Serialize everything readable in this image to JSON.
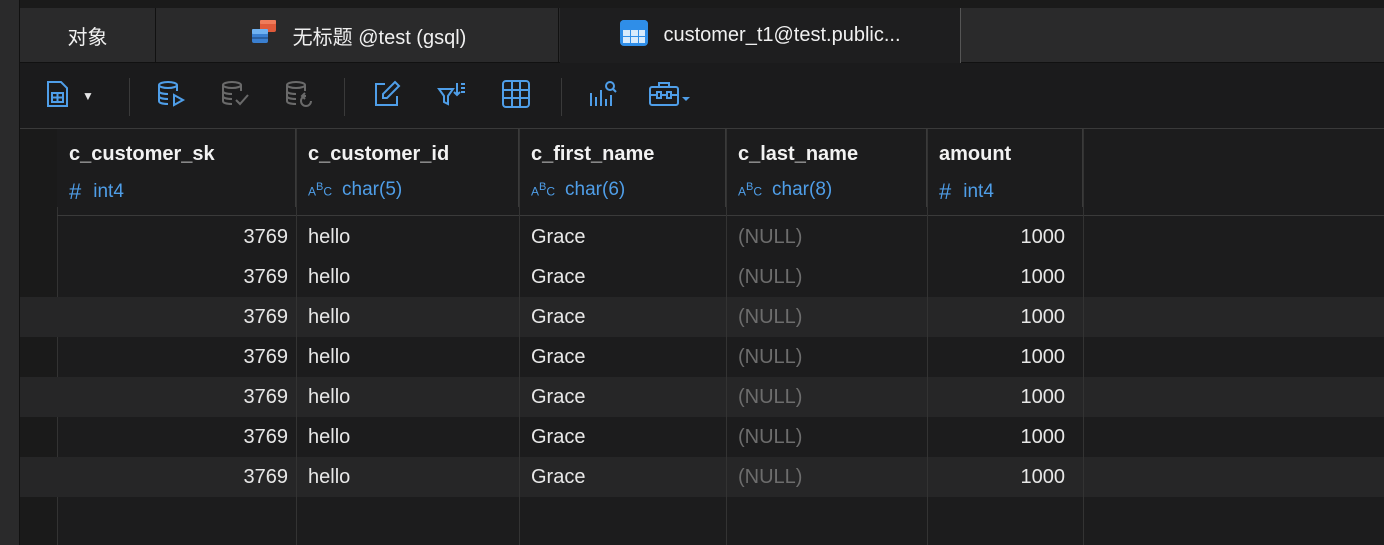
{
  "tabs": [
    {
      "label": "对象",
      "icon": "objects-tab"
    },
    {
      "label": "无标题 @test (gsql)",
      "icon": "query-editor-icon"
    },
    {
      "label": "customer_t1@test.public...",
      "icon": "table-icon"
    }
  ],
  "toolbar": {
    "icons": [
      "form-view-icon",
      "dropdown-caret-icon",
      "begin-transaction-icon",
      "commit-icon",
      "rollback-icon",
      "edit-text-icon",
      "filter-sort-icon",
      "grid-view-icon",
      "chart-search-icon",
      "tools-briefcase-icon"
    ]
  },
  "grid": {
    "columns": [
      {
        "name": "c_customer_sk",
        "type": "int4",
        "type_kind": "number"
      },
      {
        "name": "c_customer_id",
        "type": "char(5)",
        "type_kind": "text"
      },
      {
        "name": "c_first_name",
        "type": "char(6)",
        "type_kind": "text"
      },
      {
        "name": "c_last_name",
        "type": "char(8)",
        "type_kind": "text"
      },
      {
        "name": "amount",
        "type": "int4",
        "type_kind": "number"
      }
    ],
    "type_glyphs": {
      "number": "#",
      "text": "ABC"
    },
    "rows": [
      [
        "3769",
        "hello",
        "Grace",
        "(NULL)",
        "1000"
      ],
      [
        "3769",
        "hello",
        "Grace",
        "(NULL)",
        "1000"
      ],
      [
        "3769",
        "hello",
        "Grace",
        "(NULL)",
        "1000"
      ],
      [
        "3769",
        "hello",
        "Grace",
        "(NULL)",
        "1000"
      ],
      [
        "3769",
        "hello",
        "Grace",
        "(NULL)",
        "1000"
      ],
      [
        "3769",
        "hello",
        "Grace",
        "(NULL)",
        "1000"
      ],
      [
        "3769",
        "hello",
        "Grace",
        "(NULL)",
        "1000"
      ]
    ]
  },
  "colors": {
    "accent": "#4f9ee8",
    "null_text": "#6d6d6d",
    "background": "#1c1c1d"
  }
}
